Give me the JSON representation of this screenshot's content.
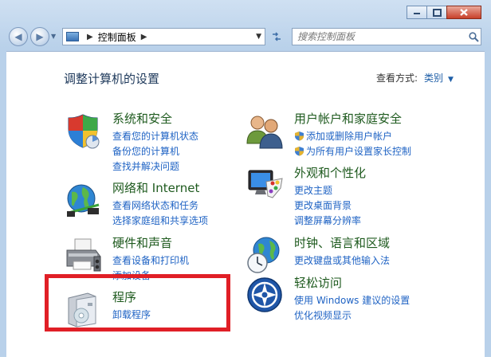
{
  "address": {
    "breadcrumb": "控制面板"
  },
  "search": {
    "placeholder": "搜索控制面板"
  },
  "page_title": "调整计算机的设置",
  "view_by": {
    "label": "查看方式:",
    "value": "类别"
  },
  "categories": [
    {
      "title": "系统和安全",
      "links": [
        "查看您的计算机状态",
        "备份您的计算机",
        "查找并解决问题"
      ]
    },
    {
      "title": "网络和 Internet",
      "links": [
        "查看网络状态和任务",
        "选择家庭组和共享选项"
      ]
    },
    {
      "title": "硬件和声音",
      "links": [
        "查看设备和打印机",
        "添加设备"
      ]
    },
    {
      "title": "程序",
      "links": [
        "卸载程序"
      ]
    },
    {
      "title": "用户帐户和家庭安全",
      "links": [
        "添加或删除用户帐户",
        "为所有用户设置家长控制"
      ]
    },
    {
      "title": "外观和个性化",
      "links": [
        "更改主题",
        "更改桌面背景",
        "调整屏幕分辨率"
      ]
    },
    {
      "title": "时钟、语言和区域",
      "links": [
        "更改键盘或其他输入法"
      ]
    },
    {
      "title": "轻松访问",
      "links": [
        "使用 Windows 建议的设置",
        "优化视频显示"
      ]
    }
  ],
  "colors": {
    "link": "#1f63c4",
    "category_title": "#1e5a1e",
    "highlight": "#e01f26"
  },
  "icons": [
    "shield-icon",
    "globe-network-icon",
    "printer-icon",
    "program-box-icon",
    "users-icon",
    "monitor-palette-icon",
    "clock-globe-icon",
    "ease-of-access-icon"
  ]
}
